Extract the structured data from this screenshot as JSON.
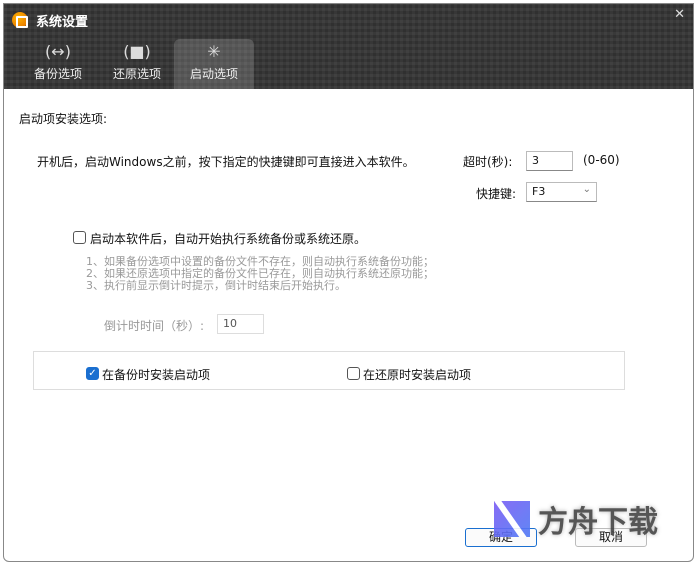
{
  "window": {
    "title": "系统设置"
  },
  "tabs": [
    {
      "label": "备份选项",
      "icon": "backup-icon"
    },
    {
      "label": "还原选项",
      "icon": "restore-icon"
    },
    {
      "label": "启动选项",
      "icon": "loading-spinner-icon",
      "active": true
    }
  ],
  "section_title": "启动项安装选项:",
  "description": "开机后，启动Windows之前，按下指定的快捷键即可直接进入本软件。",
  "timeout": {
    "label": "超时(秒):",
    "value": "3",
    "range": "(0-60)"
  },
  "hotkey": {
    "label": "快捷键:",
    "value": "F3"
  },
  "auto_run": {
    "label": "启动本软件后，自动开始执行系统备份或系统还原。",
    "checked": false,
    "notes": [
      "1、如果备份选项中设置的备份文件不存在，则自动执行系统备份功能；",
      "2、如果还原选项中指定的备份文件已存在，则自动执行系统还原功能；",
      "3、执行前显示倒计时提示，倒计时结束后开始执行。"
    ],
    "countdown_label": "倒计时时间（秒）:",
    "countdown_value": "10"
  },
  "install_on_backup": {
    "label": "在备份时安装启动项",
    "checked": true
  },
  "install_on_restore": {
    "label": "在还原时安装启动项",
    "checked": false
  },
  "buttons": {
    "ok": "确定",
    "cancel": "取消"
  },
  "watermark": "方舟下载",
  "colors": {
    "accent": "#1a6fd0",
    "header": "#363636"
  }
}
